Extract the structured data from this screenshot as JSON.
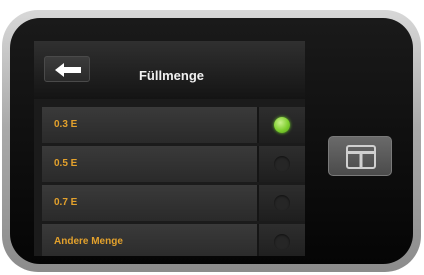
{
  "screen": {
    "title": "Füllmenge",
    "options": [
      {
        "label": "0.3 E",
        "selected": true
      },
      {
        "label": "0.5 E",
        "selected": false
      },
      {
        "label": "0.7 E",
        "selected": false
      },
      {
        "label": "Andere Menge",
        "selected": false
      }
    ]
  },
  "icons": {
    "back": "arrow-left-icon",
    "home": "t-logo-icon"
  },
  "colors": {
    "label": "#e3a12c",
    "selected_radio": "#7fce2f",
    "background": "#1b1b1b"
  }
}
